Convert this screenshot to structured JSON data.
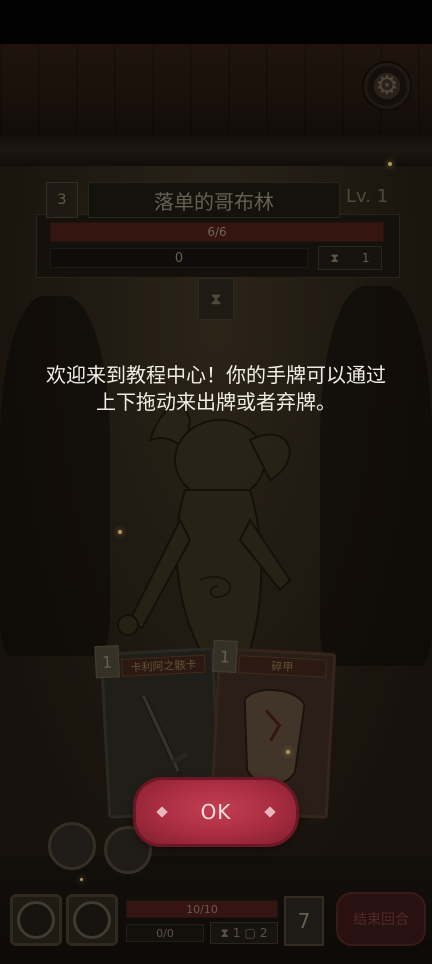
{
  "enemy": {
    "level_badge": "3",
    "name": "落单的哥布林",
    "level_text": "Lv. 1",
    "hp_text": "6/6",
    "block_text": "0",
    "intent_icon": "hourglass-icon",
    "intent_value": "1"
  },
  "hand": {
    "cards": [
      {
        "cost": "1",
        "title": "卡利阿之骸卡",
        "art": "sword-icon"
      },
      {
        "cost": "1",
        "title": "碎甲",
        "art": "armor-icon"
      }
    ]
  },
  "tutorial": {
    "line1": "欢迎来到教程中心！你的手牌可以通过",
    "line2": "上下拖动来出牌或者弃牌。",
    "ok_label": "OK"
  },
  "player": {
    "hp_text": "10/10",
    "block_text": "0/0",
    "draw_value": "1",
    "discard_value": "2",
    "deck_count": "7",
    "end_turn_label": "结束回合"
  },
  "colors": {
    "ok_button": "#a82c40",
    "hp_fill": "#4b1c17",
    "text_light": "#f1ede4"
  }
}
